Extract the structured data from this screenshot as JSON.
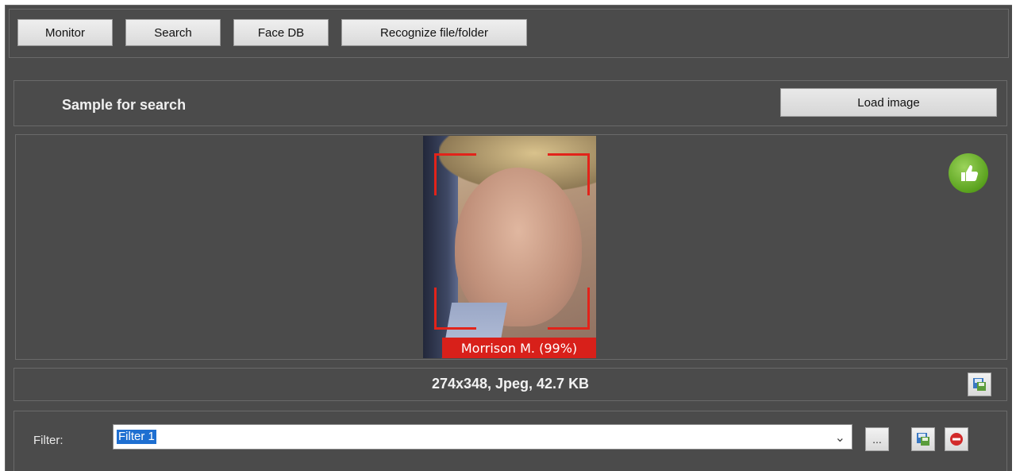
{
  "toolbar": {
    "tabs": [
      {
        "label": "Monitor"
      },
      {
        "label": "Search"
      },
      {
        "label": "Face DB"
      },
      {
        "label": "Recognize file/folder"
      }
    ]
  },
  "sample": {
    "title": "Sample for search",
    "load_button": "Load image",
    "match_label": "Morrison M. (99%)",
    "match_color": "#d8201a",
    "status_icon": "thumbs-up-icon",
    "status_color": "#5aa21e"
  },
  "image_info": {
    "text": "274x348, Jpeg, 42.7 KB",
    "save_icon": "save-icon"
  },
  "filter": {
    "label": "Filter:",
    "value": "Filter 1",
    "browse_label": "...",
    "save_icon": "save-icon",
    "remove_icon": "remove-icon"
  }
}
